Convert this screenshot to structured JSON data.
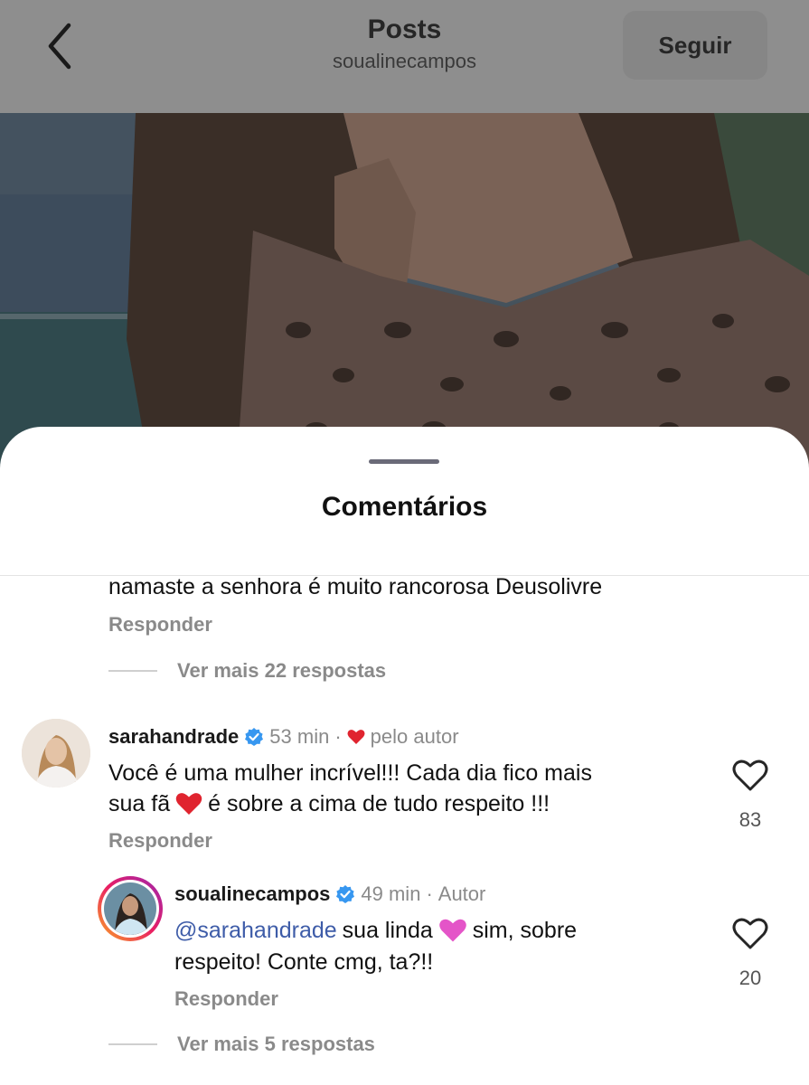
{
  "header": {
    "title": "Posts",
    "subtitle": "soualinecampos",
    "follow_label": "Seguir"
  },
  "sheet": {
    "title": "Comentários"
  },
  "prev_comment": {
    "text": "namaste a senhora é muito rancorosa Deusolivre",
    "reply_label": "Responder",
    "more_replies": "Ver mais 22 respostas"
  },
  "comment1": {
    "username": "sarahandrade",
    "time": "53 min",
    "separator": "·",
    "liked_by_author": "pelo autor",
    "text_line1": "Você é uma mulher incrível!!! Cada dia fico mais",
    "text_line2_a": "sua fã",
    "text_line2_b": "é sobre a cima de tudo respeito !!!",
    "reply_label": "Responder",
    "likes": "83"
  },
  "reply1": {
    "username": "soualinecampos",
    "time": "49 min",
    "separator": "·",
    "role": "Autor",
    "mention": "@sarahandrade",
    "text_line1_a": "sua linda",
    "text_line1_b": "sim, sobre",
    "text_line2": "respeito! Conte cmg, ta?!!",
    "reply_label": "Responder",
    "likes": "20",
    "more_replies": "Ver mais 5 respostas"
  },
  "colors": {
    "verified": "#3797f0",
    "heart_red": "#e0242f",
    "heart_pink": "#e455c8",
    "mention": "#3e5ca8"
  }
}
